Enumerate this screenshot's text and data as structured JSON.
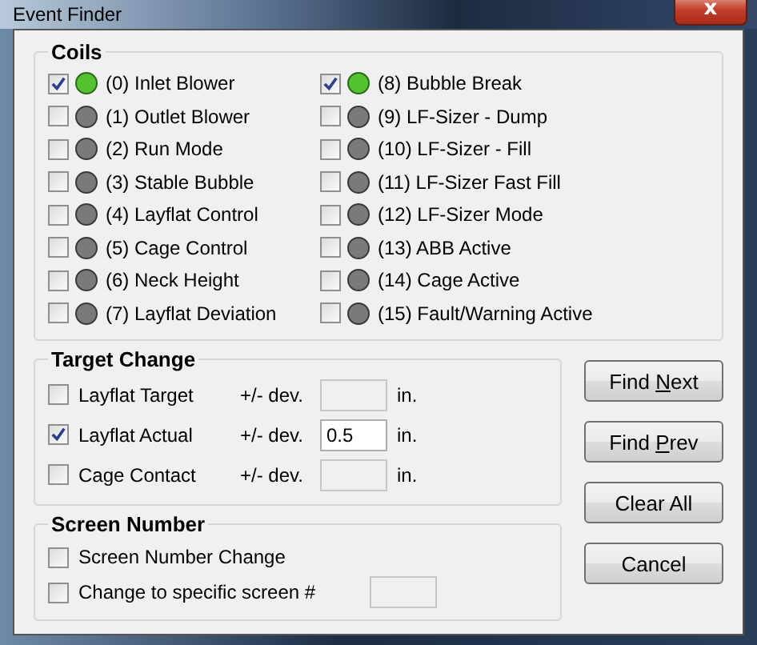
{
  "window": {
    "title": "Event Finder",
    "close": "x"
  },
  "coils": {
    "title": "Coils",
    "items": [
      {
        "label": "(0) Inlet Blower",
        "checked": true,
        "lit": true
      },
      {
        "label": "(1) Outlet Blower",
        "checked": false,
        "lit": false
      },
      {
        "label": "(2) Run Mode",
        "checked": false,
        "lit": false
      },
      {
        "label": "(3) Stable Bubble",
        "checked": false,
        "lit": false
      },
      {
        "label": "(4) Layflat Control",
        "checked": false,
        "lit": false
      },
      {
        "label": "(5) Cage Control",
        "checked": false,
        "lit": false
      },
      {
        "label": "(6) Neck Height",
        "checked": false,
        "lit": false
      },
      {
        "label": "(7) Layflat Deviation",
        "checked": false,
        "lit": false
      },
      {
        "label": "(8) Bubble Break",
        "checked": true,
        "lit": true
      },
      {
        "label": "(9) LF-Sizer - Dump",
        "checked": false,
        "lit": false
      },
      {
        "label": "(10) LF-Sizer - Fill",
        "checked": false,
        "lit": false
      },
      {
        "label": "(11) LF-Sizer Fast Fill",
        "checked": false,
        "lit": false
      },
      {
        "label": "(12) LF-Sizer Mode",
        "checked": false,
        "lit": false
      },
      {
        "label": "(13) ABB Active",
        "checked": false,
        "lit": false
      },
      {
        "label": "(14) Cage Active",
        "checked": false,
        "lit": false
      },
      {
        "label": "(15) Fault/Warning Active",
        "checked": false,
        "lit": false
      }
    ]
  },
  "target_change": {
    "title": "Target Change",
    "rows": [
      {
        "label": "Layflat Target",
        "checked": false,
        "dev_label": "+/- dev.",
        "value": "",
        "disabled": true,
        "unit": "in."
      },
      {
        "label": "Layflat Actual",
        "checked": true,
        "dev_label": "+/- dev.",
        "value": "0.5",
        "disabled": false,
        "unit": "in."
      },
      {
        "label": "Cage Contact",
        "checked": false,
        "dev_label": "+/- dev.",
        "value": "",
        "disabled": true,
        "unit": "in."
      }
    ]
  },
  "screen_number": {
    "title": "Screen Number",
    "rows": [
      {
        "kind": "check",
        "label": "Screen Number Change",
        "checked": false
      },
      {
        "kind": "check_field",
        "label": "Change to specific screen #",
        "checked": false,
        "value": "",
        "disabled": true
      }
    ]
  },
  "buttons": [
    {
      "before": "Find ",
      "key": "N",
      "after": "ext"
    },
    {
      "before": "Find ",
      "key": "P",
      "after": "rev"
    },
    {
      "before": "Clear All"
    },
    {
      "before": "Cancel"
    }
  ]
}
